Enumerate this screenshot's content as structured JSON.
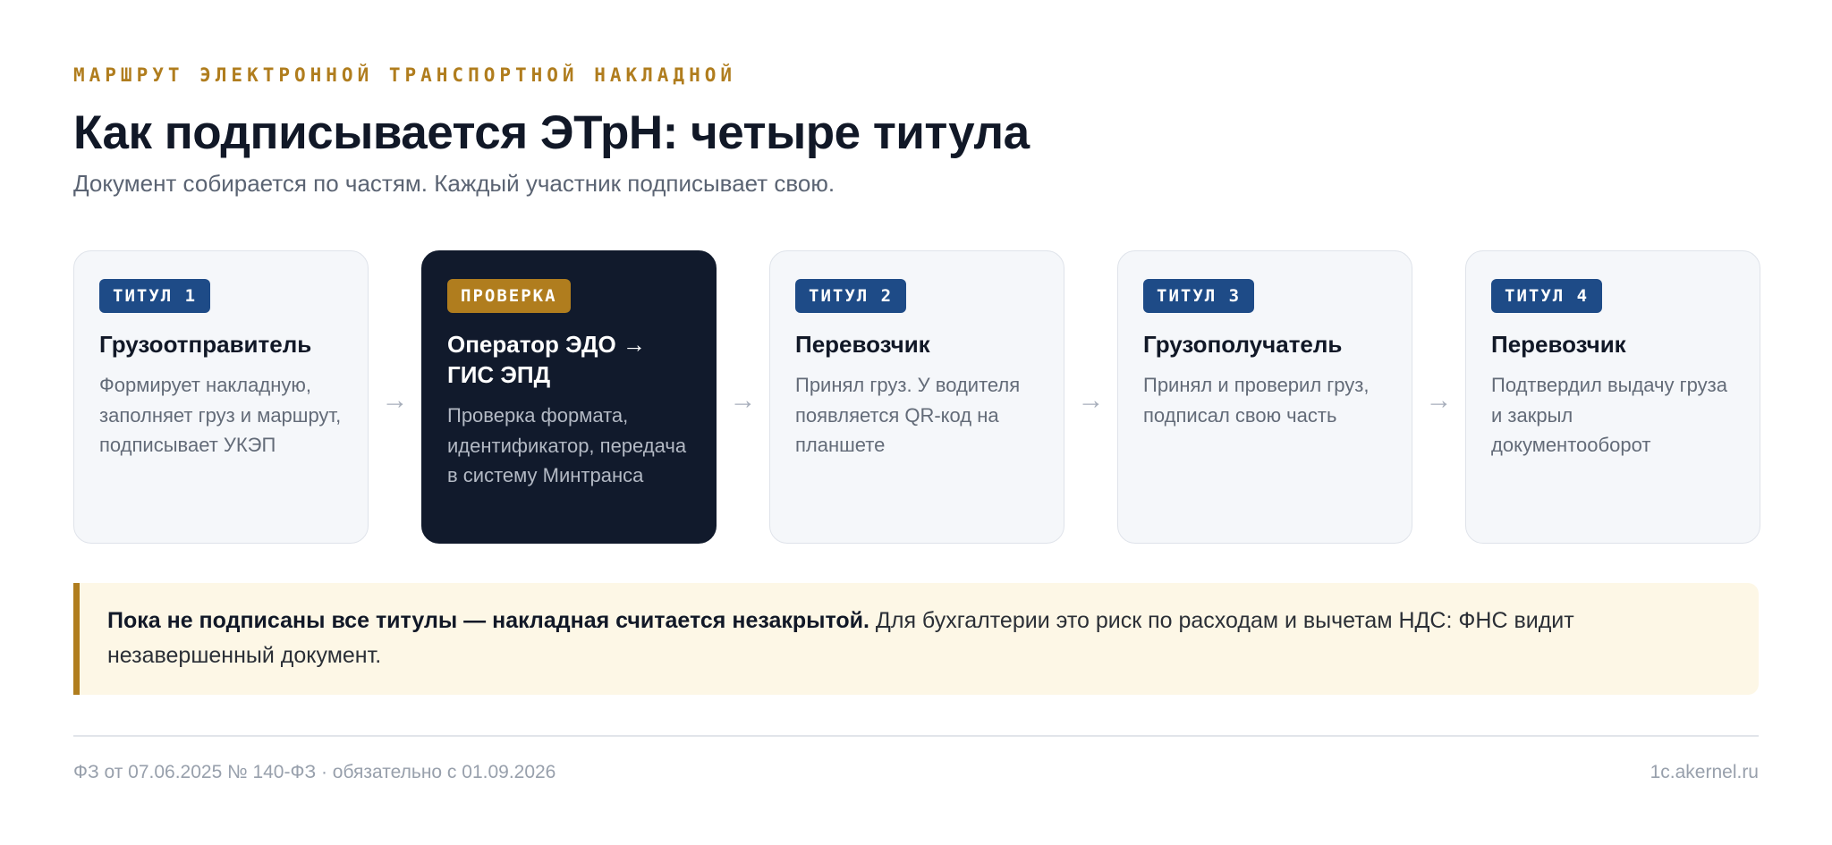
{
  "header": {
    "kicker": "МАРШРУТ ЭЛЕКТРОННОЙ ТРАНСПОРТНОЙ НАКЛАДНОЙ",
    "title": "Как подписывается ЭТрН: четыре титула",
    "subtitle": "Документ собирается по частям. Каждый участник подписывает свою."
  },
  "flow": {
    "arrow": "→",
    "steps": [
      {
        "badge": "ТИТУЛ 1",
        "title": "Грузоотправитель",
        "text": "Формирует накладную, заполняет груз и маршрут, подписывает УКЭП"
      },
      {
        "badge": "ПРОВЕРКА",
        "title": "Оператор ЭДО → ГИС ЭПД",
        "text": "Проверка формата, идентификатор, передача в систему Минтранса"
      },
      {
        "badge": "ТИТУЛ 2",
        "title": "Перевозчик",
        "text": "Принял груз. У водителя появляется QR-код на планшете"
      },
      {
        "badge": "ТИТУЛ 3",
        "title": "Грузополучатель",
        "text": "Принял и проверил груз, подписал свою часть"
      },
      {
        "badge": "ТИТУЛ 4",
        "title": "Перевозчик",
        "text": "Подтвердил выдачу груза и закрыл документооборот"
      }
    ]
  },
  "note": {
    "strong": "Пока не подписаны все титулы — накладная считается незакрытой.",
    "text": " Для бухгалтерии это риск по расходам и вычетам НДС: ФНС видит незавершенный документ."
  },
  "footer": {
    "left": "ФЗ от 07.06.2025 № 140-ФЗ · обязательно с 01.09.2026",
    "right": "1c.akernel.ru"
  },
  "colors": {
    "accent": "#b07d1e",
    "badge": "#1e4b87",
    "dark_card": "#111a2c",
    "note_bg": "#fdf7e6"
  }
}
